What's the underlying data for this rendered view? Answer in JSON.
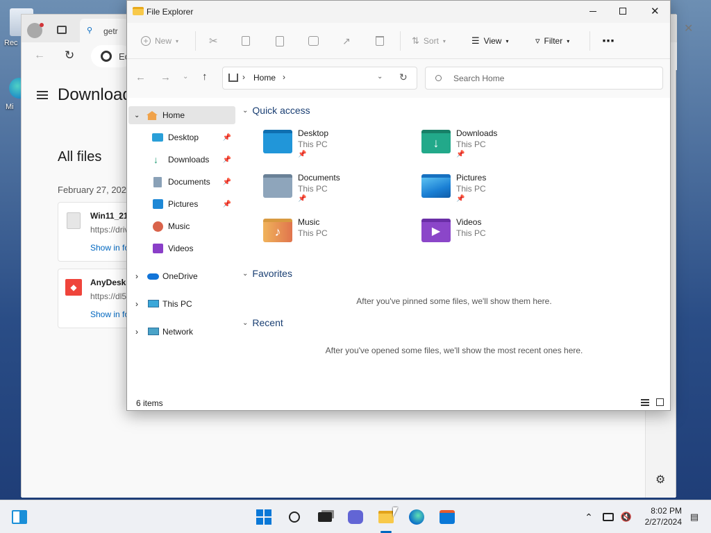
{
  "desktop": {
    "icon1_label": "Rec",
    "icon2_label": "Mi"
  },
  "edge": {
    "tab_text": "getr",
    "address_text": "Ec",
    "page_title": "Download",
    "section_title": "All files",
    "date_label": "February 27, 2024",
    "items": [
      {
        "name": "Win11_21",
        "url": "https://driv",
        "action": "Show in fo"
      },
      {
        "name": "AnyDesk.",
        "url": "https://dl5.",
        "action": "Show in fo"
      }
    ]
  },
  "explorer": {
    "title": "File Explorer",
    "toolbar": {
      "new": "New",
      "sort": "Sort",
      "view": "View",
      "filter": "Filter"
    },
    "address": {
      "location": "Home"
    },
    "search": {
      "placeholder": "Search Home"
    },
    "nav": {
      "home": "Home",
      "pinned": [
        "Desktop",
        "Downloads",
        "Documents",
        "Pictures"
      ],
      "folders": [
        "Music",
        "Videos"
      ],
      "onedrive": "OneDrive",
      "thispc": "This PC",
      "network": "Network"
    },
    "quick_access": {
      "title": "Quick access",
      "items": [
        {
          "name": "Desktop",
          "sub": "This PC",
          "pinned": true
        },
        {
          "name": "Downloads",
          "sub": "This PC",
          "pinned": true
        },
        {
          "name": "Documents",
          "sub": "This PC",
          "pinned": true
        },
        {
          "name": "Pictures",
          "sub": "This PC",
          "pinned": true
        },
        {
          "name": "Music",
          "sub": "This PC",
          "pinned": false
        },
        {
          "name": "Videos",
          "sub": "This PC",
          "pinned": false
        }
      ]
    },
    "favorites": {
      "title": "Favorites",
      "empty": "After you've pinned some files, we'll show them here."
    },
    "recent": {
      "title": "Recent",
      "empty": "After you've opened some files, we'll show the most recent ones here."
    },
    "status": {
      "count": "6 items"
    }
  },
  "taskbar": {
    "time": "8:02 PM",
    "date": "2/27/2024"
  },
  "colors": {
    "accent": "#0067c0",
    "section_heading": "#1a3f73",
    "folder_yellow": "#f8c94a"
  }
}
